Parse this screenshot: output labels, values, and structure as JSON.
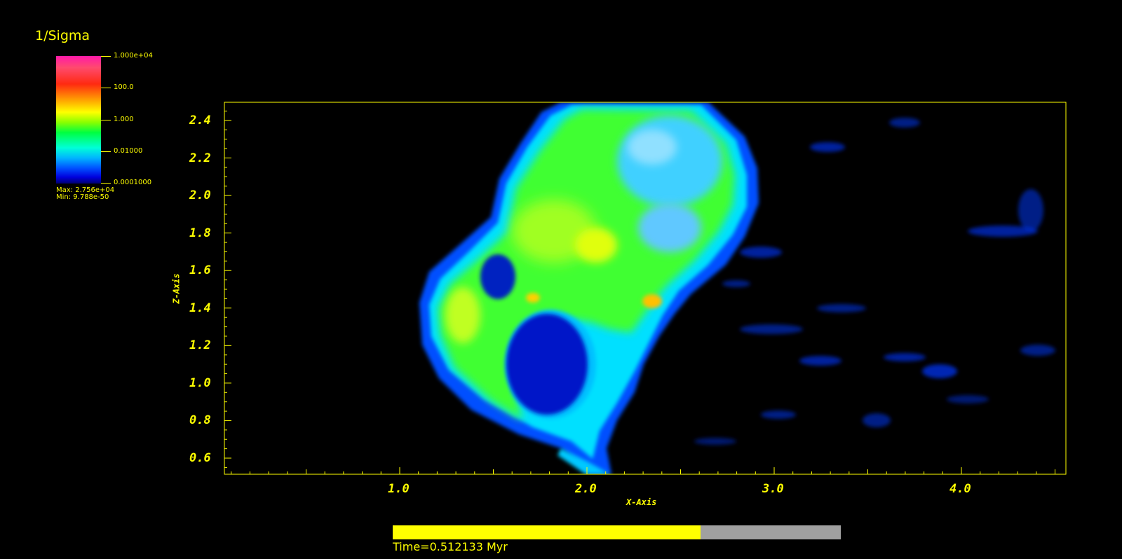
{
  "legend": {
    "title": "1/Sigma",
    "labels": [
      "1.000e+04",
      "100.0",
      "1.000",
      "0.01000",
      "0.0001000"
    ],
    "max": "Max:  2.756e+04",
    "min": "Min:  9.788e-50"
  },
  "axes": {
    "x_title": "X-Axis",
    "y_title": "Z-Axis",
    "x_ticks": [
      "1.0",
      "2.0",
      "3.0",
      "4.0"
    ],
    "y_ticks": [
      "2.4",
      "2.2",
      "2.0",
      "1.8",
      "1.6",
      "1.4",
      "1.2",
      "1.0",
      "0.8",
      "0.6"
    ]
  },
  "time": {
    "label": "Time=0.512133 Myr",
    "progress": 0.6875
  },
  "colors": {
    "axis": "#ffff00",
    "background": "#000000",
    "bar_track": "#a0a0a0"
  }
}
